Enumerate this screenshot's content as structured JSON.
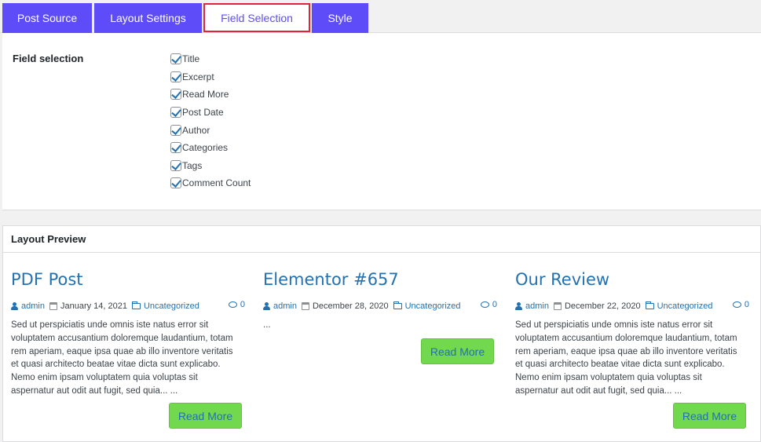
{
  "tabs": [
    {
      "label": "Post Source"
    },
    {
      "label": "Layout Settings"
    },
    {
      "label": "Field Selection"
    },
    {
      "label": "Style"
    }
  ],
  "field_selection": {
    "label": "Field selection",
    "items": [
      {
        "label": "Title",
        "checked": true
      },
      {
        "label": "Excerpt",
        "checked": true
      },
      {
        "label": "Read More",
        "checked": true
      },
      {
        "label": "Post Date",
        "checked": true
      },
      {
        "label": "Author",
        "checked": true
      },
      {
        "label": "Categories",
        "checked": true
      },
      {
        "label": "Tags",
        "checked": true
      },
      {
        "label": "Comment Count",
        "checked": true
      }
    ]
  },
  "preview": {
    "title": "Layout Preview",
    "posts": [
      {
        "title": "PDF Post",
        "author": "admin",
        "date": "January 14, 2021",
        "category": "Uncategorized",
        "comments": "0",
        "excerpt": "Sed ut perspiciatis unde omnis iste natus error sit voluptatem accusantium doloremque laudantium, totam rem aperiam, eaque ipsa quae ab illo inventore veritatis et quasi architecto beatae vitae dicta sunt explicabo. Nemo enim ipsam voluptatem quia voluptas sit aspernatur aut odit aut fugit, sed quia... ...",
        "button": "Read More"
      },
      {
        "title": "Elementor #657",
        "author": "admin",
        "date": "December 28, 2020",
        "category": "Uncategorized",
        "comments": "0",
        "excerpt": "...",
        "button": "Read More"
      },
      {
        "title": "Our Review",
        "author": "admin",
        "date": "December 22, 2020",
        "category": "Uncategorized",
        "comments": "0",
        "excerpt": "Sed ut perspiciatis unde omnis iste natus error sit voluptatem accusantium doloremque laudantium, totam rem aperiam, eaque ipsa quae ab illo inventore veritatis et quasi architecto beatae vitae dicta sunt explicabo. Nemo enim ipsam voluptatem quia voluptas sit aspernatur aut odit aut fugit, sed quia... ...",
        "button": "Read More"
      }
    ]
  },
  "colors": {
    "tab_bg": "#5e4cf9",
    "active_tab_border": "#e0243f",
    "link": "#2271b1",
    "button_bg": "#72d84d"
  }
}
